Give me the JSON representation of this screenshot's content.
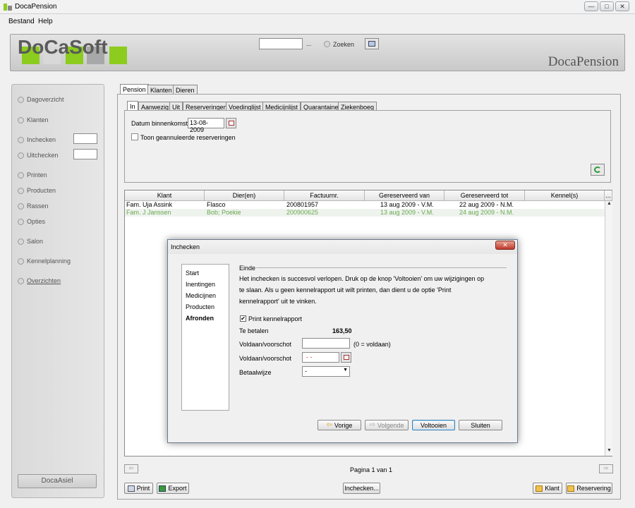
{
  "window": {
    "title": "DocaPension",
    "min": "—",
    "max": "□",
    "close": "✕"
  },
  "menu": [
    "Bestand",
    "Help"
  ],
  "header": {
    "logo": "DoCaSoft",
    "brand": "DocaPension",
    "search_dots": "...",
    "search_label": "Zoeken"
  },
  "sidebar": {
    "items": [
      "Dagoverzicht",
      "Klanten",
      "Inchecken",
      "Uitchecken",
      "Printen",
      "Producten",
      "Rassen",
      "Opties",
      "Salon",
      "Kennelplanning",
      "Overzichten"
    ],
    "footer_button": "DocaAsiel"
  },
  "tabs_main": [
    "Pension",
    "Klanten",
    "Dieren"
  ],
  "tabs_sub": [
    "In",
    "Aanwezig",
    "Uit",
    "Reserveringen",
    "Voedinglijst",
    "Medicijnlijst",
    "Quarantaine",
    "Ziekenboeg"
  ],
  "filter": {
    "date_label": "Datum binnenkomst",
    "date_value": "13-08-2009",
    "show_cancelled": "Toon geannuleerde reserveringen"
  },
  "grid": {
    "columns": [
      "Klant",
      "Dier(en)",
      "Factuurnr.",
      "Gereserveerd van",
      "Gereserveerd tot",
      "Kennel(s)"
    ],
    "rows": [
      [
        "Fam. Uja Assink",
        "Flasco",
        "200801957",
        "13 aug 2009  - V.M.",
        "22 aug 2009  - N.M.",
        ""
      ],
      [
        "Fam. J Janssen",
        "Bob; Poekie",
        "200900625",
        "13 aug 2009  - V.M.",
        "24 aug 2009  - N.M.",
        ""
      ]
    ],
    "more": "..."
  },
  "pager": {
    "info": "Pagina 1 van 1",
    "prev": "⇦",
    "next": "⇨"
  },
  "bottom": {
    "print": "Print",
    "export": "Export",
    "checkin": "Inchecken...",
    "klant": "Klant",
    "reservering": "Reservering"
  },
  "dialog": {
    "title": "Inchecken",
    "close": "✕",
    "steps": [
      "Start",
      "Inentingen",
      "Medicijnen",
      "Producten",
      "Afronden"
    ],
    "section": "Einde",
    "message": [
      "Het inchecken is succesvol verlopen. Druk op de knop 'Voltooien' om uw wijzigingen op",
      "te slaan. Als u geen kennelrapport uit wilt printen, dan dient u de optie 'Print",
      "kennelrapport' uit te vinken."
    ],
    "print_report": "Print kennelrapport",
    "check": "✔",
    "to_pay_label": "Te betalen",
    "to_pay_value": "163,50",
    "paid_label": "Voldaan/voorschot",
    "paid_hint": "(0 = voldaan)",
    "paid_date_label": "Voldaan/voorschot",
    "paid_date_value": "-  -",
    "method_label": "Betaalwijze",
    "method_value": "-",
    "buttons": {
      "prev": "Vorige",
      "next": "Volgende",
      "finish": "Voltooien",
      "close": "Sluiten"
    }
  },
  "colors": {
    "green": "#7dbd3a",
    "row2_text": "#6aa84f",
    "logo_green": "#8ccc1e"
  }
}
